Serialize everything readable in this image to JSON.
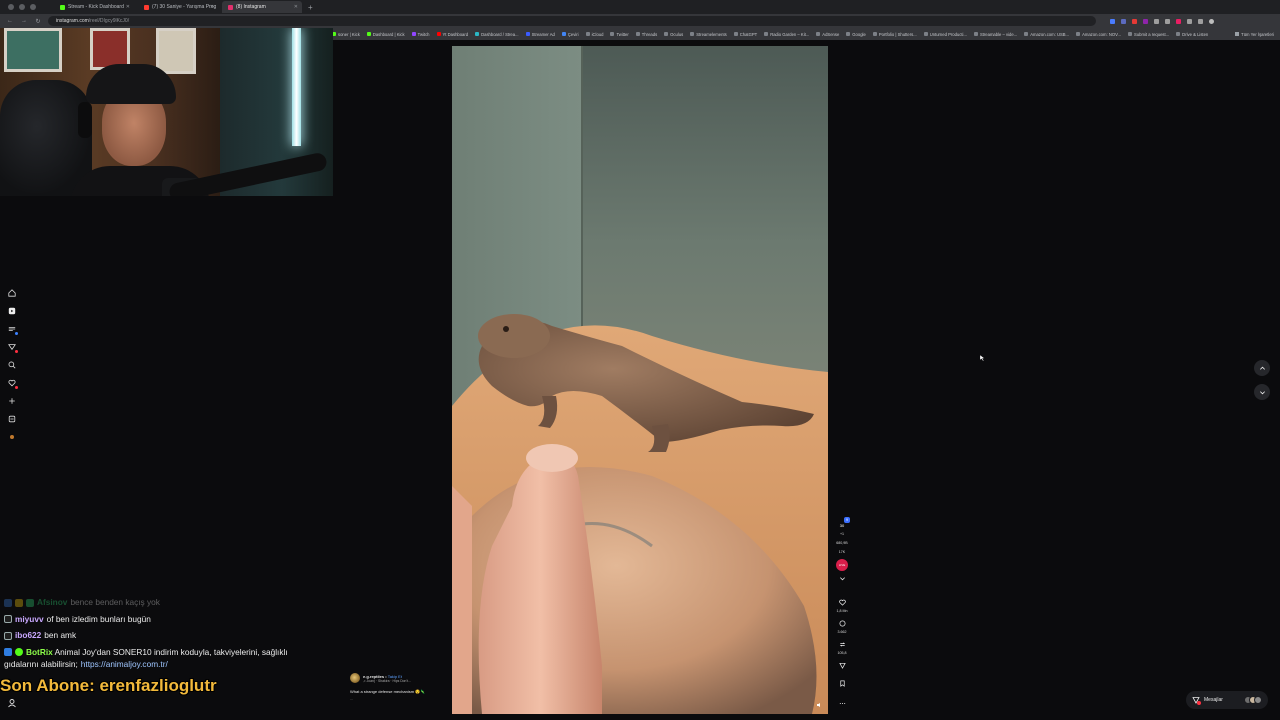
{
  "browser": {
    "tabs": [
      {
        "label": "Stream - Kick Dashboard",
        "color": "#53fc18"
      },
      {
        "label": "(7) 30 Saniye - Yarışma Prog",
        "color": "#ff3b30"
      },
      {
        "label": "(8) Instagram",
        "color": "#e1306c"
      }
    ],
    "url": "instagram.com",
    "url_path": "/reel/DIgcy9lKcJ0/",
    "bookmarks": [
      "soner | Kick",
      "Dashboard | Kick",
      "Twitch",
      "Yt Dashboard",
      "Dashboard / Strea...",
      "Streamer Ad",
      "Çeviri",
      "iCloud",
      "Twitter",
      "Threads",
      "Oculus",
      "Streamelements",
      "ChatGPT",
      "Radio Garden – Kit...",
      "AdSense",
      "Google",
      "Portfolio | Shutters...",
      "Unturned Producti...",
      "Streamable – vide...",
      "Amazon.com: USB...",
      "Amazon.com: NOV...",
      "Submit a request...",
      "Drive & Listen"
    ],
    "bookmark_right": "Tüm Yer İşaretleri"
  },
  "reel": {
    "author": "e.g.reptiles",
    "follow_label": "Takip Et",
    "audio": "♫ Joan) · Shakira · Hips Don't...",
    "caption": "What a strange defense mechanism 😲🦎",
    "more": "...",
    "counts": {
      "views": "30",
      "views_sub": "+1",
      "viewers_top": "680,9B",
      "viewers_sub": "17K",
      "likes": "1,8 Mn",
      "comments": "3.662",
      "shares": "105,8",
      "notif_badge": "9"
    },
    "live_label": "LIVE"
  },
  "messages": {
    "label": "Mesajlar"
  },
  "chat": {
    "lines": [
      {
        "user": "Afsinov",
        "text": "bence benden kaçış yok",
        "user_color": "#2ecc71",
        "faded": true
      },
      {
        "user": "miyuvv",
        "text": "of ben izledim bunları bugün",
        "user_color": "#c9a8ff",
        "faded": false
      },
      {
        "user": "ibo622",
        "text": "ben amk",
        "user_color": "#c9a8ff",
        "faded": false
      }
    ],
    "bot": {
      "user": "BotRix",
      "user_color": "#8dff4a",
      "text": "Animal Joy'dan SONER10 indirim koduyla, takviyelerini, sağlıklı",
      "text2": "gıdalarını alabilirsin;",
      "link": "https://animaljoy.com.tr/"
    }
  },
  "subscriber_banner": "Son Abone: erenfazlioglutr"
}
